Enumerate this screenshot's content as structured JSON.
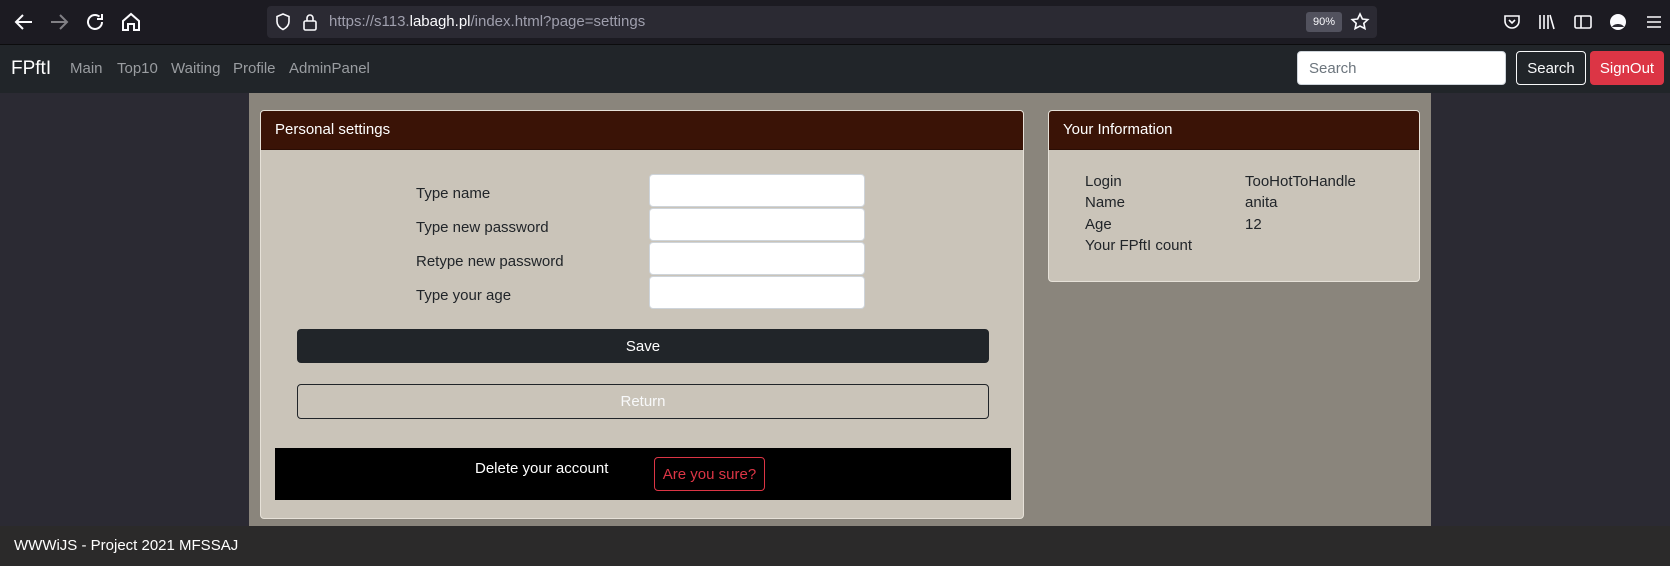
{
  "browser": {
    "url_prefix": "https://s113.",
    "url_host": "labagh.pl",
    "url_path": "/index.html?page=settings",
    "zoom": "90%"
  },
  "navbar": {
    "brand": "FPftI",
    "links": [
      "Main",
      "Top10",
      "Waiting",
      "Profile",
      "AdminPanel"
    ],
    "search_placeholder": "Search",
    "search_button": "Search",
    "signout_button": "SignOut"
  },
  "settings": {
    "title": "Personal settings",
    "fields": [
      {
        "label": "Type name",
        "value": ""
      },
      {
        "label": "Type new password",
        "value": ""
      },
      {
        "label": "Retype new password",
        "value": ""
      },
      {
        "label": "Type your age",
        "value": ""
      }
    ],
    "save_button": "Save",
    "return_button": "Return",
    "delete_label": "Delete your account",
    "delete_confirm_button": "Are you sure?"
  },
  "info": {
    "title": "Your Information",
    "rows": [
      {
        "key": "Login",
        "value": "TooHotToHandle"
      },
      {
        "key": "Name",
        "value": "anita"
      },
      {
        "key": "Age",
        "value": "12"
      },
      {
        "key": "Your FPftI count",
        "value": ""
      }
    ]
  },
  "footer": {
    "text": "WWWiJS - Project 2021 MFSSAJ"
  },
  "colors": {
    "card_header": "#3a1306",
    "card_body": "#cac4b9",
    "main_bg": "#8a857c",
    "signout": "#dc3545"
  }
}
